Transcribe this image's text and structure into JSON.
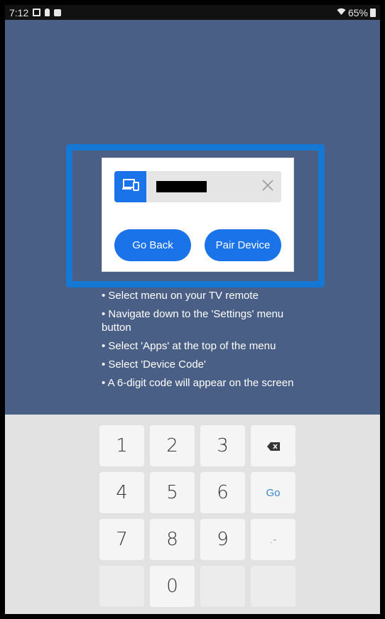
{
  "status_bar": {
    "time": "7:12",
    "battery": "65%"
  },
  "dialog": {
    "device_name": "",
    "back_label": "Go Back",
    "pair_label": "Pair Device"
  },
  "instructions": [
    "• Select menu on your TV remote",
    "• Navigate down to the 'Settings' menu button",
    "• Select 'Apps' at the top of the menu",
    "• Select 'Device Code'",
    "• A 6-digit code will appear on the screen"
  ],
  "keypad": {
    "k1": "1",
    "k2": "2",
    "k3": "3",
    "k4": "4",
    "k5": "5",
    "k6": "6",
    "k7": "7",
    "k8": "8",
    "k9": "9",
    "k0": "0",
    "go": "Go",
    "sym": ".-",
    "dot": "."
  },
  "colors": {
    "background": "#4a5f86",
    "accent": "#1a73e8",
    "highlight": "#1478d4"
  }
}
